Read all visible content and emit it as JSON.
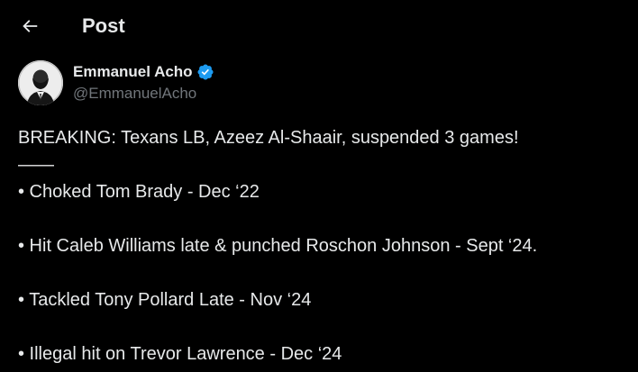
{
  "header": {
    "back_icon": "arrow-left-icon",
    "title": "Post"
  },
  "author": {
    "name": "Emmanuel Acho",
    "handle": "@EmmanuelAcho",
    "verified_icon": "verified-badge-icon",
    "verified_color": "#1d9bf0"
  },
  "post": {
    "headline": "BREAKING: Texans LB, Azeez Al-Shaair, suspended 3 games!",
    "divider": "——",
    "items": [
      "• Choked Tom Brady - Dec ‘22",
      "• Hit Caleb Williams late & punched Roschon Johnson - Sept ‘24.",
      "• Tackled Tony Pollard Late - Nov ‘24",
      "• Illegal hit on Trevor Lawrence - Dec ‘24"
    ]
  },
  "colors": {
    "background": "#000000",
    "text_primary": "#e7e9ea",
    "text_secondary": "#71767b",
    "accent": "#1d9bf0"
  }
}
